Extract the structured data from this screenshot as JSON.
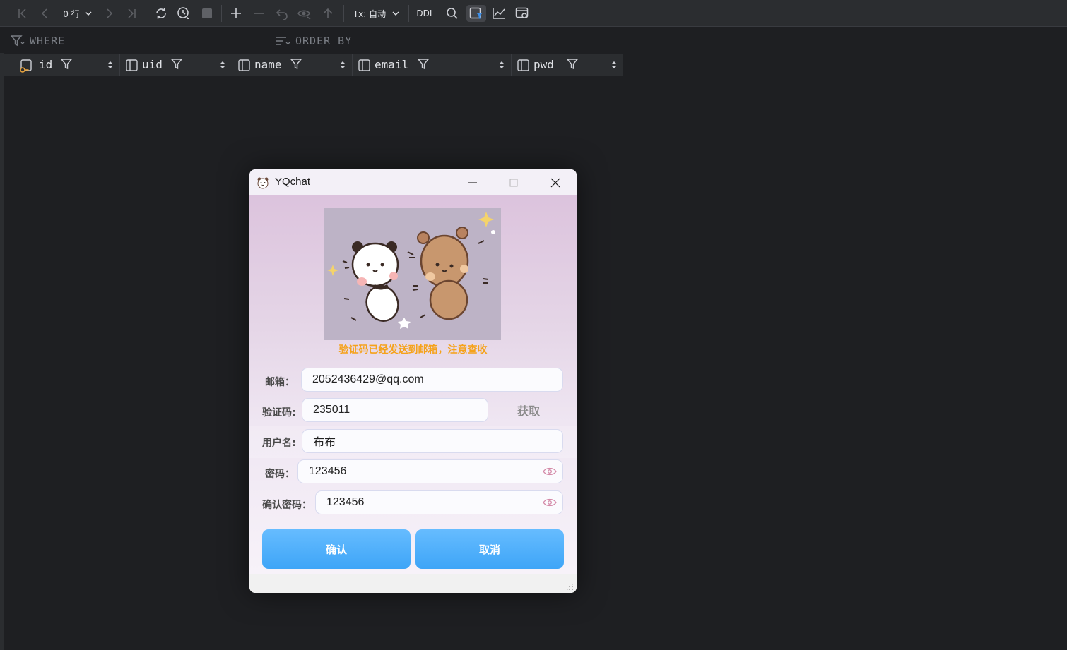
{
  "toolbar": {
    "rows_label": "0 行",
    "tx_label": "Tx: 自动",
    "ddl_label": "DDL"
  },
  "filter": {
    "where_label": "WHERE",
    "orderby_label": "ORDER BY"
  },
  "columns": [
    {
      "name": "id"
    },
    {
      "name": "uid"
    },
    {
      "name": "name"
    },
    {
      "name": "email"
    },
    {
      "name": "pwd"
    }
  ],
  "dialog": {
    "title": "YQchat",
    "notice": "验证码已经发送到邮箱，注意查收",
    "fields": {
      "email": {
        "label": "邮箱：",
        "value": "2052436429@qq.com"
      },
      "code": {
        "label": "验证码:",
        "value": "235011"
      },
      "username": {
        "label": "用户名:",
        "value": "布布"
      },
      "password": {
        "label": "密码：",
        "value": "123456"
      },
      "confirm": {
        "label": "确认密码：",
        "value": "123456"
      }
    },
    "get_code_label": "获取",
    "confirm_label": "确认",
    "cancel_label": "取消"
  },
  "colors": {
    "ide_background": "#1e1f22",
    "toolbar_background": "#2b2d30",
    "notice": "#f5a21a",
    "button_blue": "#4aaefa"
  }
}
